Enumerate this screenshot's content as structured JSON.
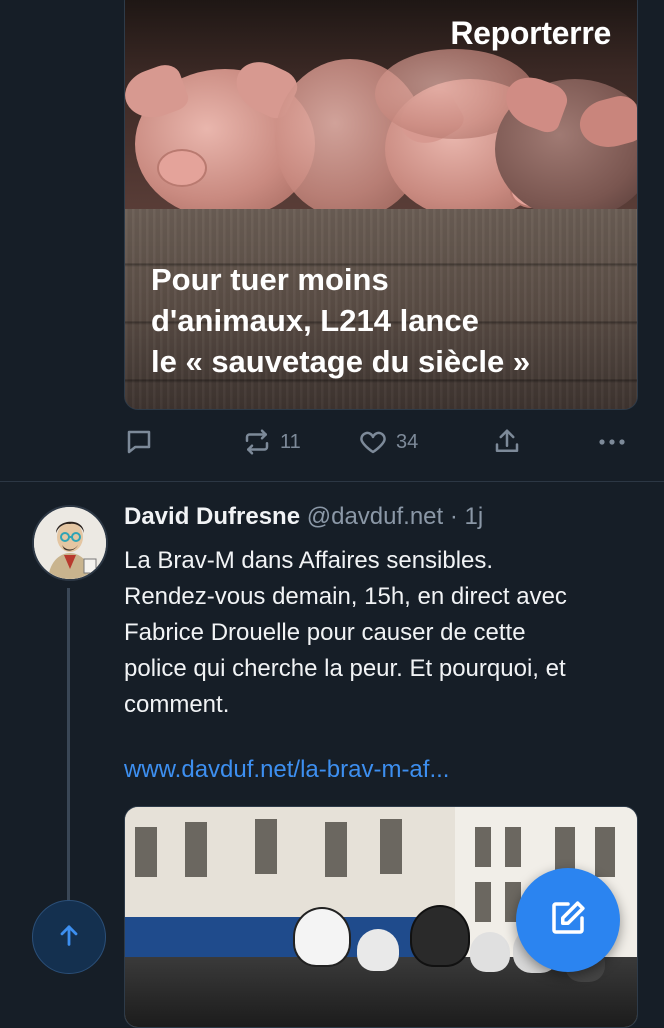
{
  "card": {
    "brand": "Reporterre",
    "headline": "Pour tuer moins\nd'animaux, L214 lance\nle « sauvetage du siècle »"
  },
  "actions": {
    "reply_icon": "reply-icon",
    "repost_icon": "repost-icon",
    "repost_count": "11",
    "like_icon": "heart-icon",
    "like_count": "34",
    "share_icon": "share-icon",
    "more_icon": "more-icon"
  },
  "post": {
    "author_name": "David Dufresne",
    "author_handle": "@davduf.net",
    "separator": " · ",
    "time": "1j",
    "body": "La Brav-M dans Affaires sensibles.\nRendez-vous demain, 15h, en direct avec\nFabrice Drouelle pour causer de cette\npolice qui cherche la peur. Et pourquoi, et\ncomment.",
    "link": "www.davduf.net/la-brav-m-af..."
  },
  "colors": {
    "background": "#161e27",
    "accent": "#2b84f0",
    "link": "#3d8ff0",
    "muted": "#8b98a7"
  }
}
